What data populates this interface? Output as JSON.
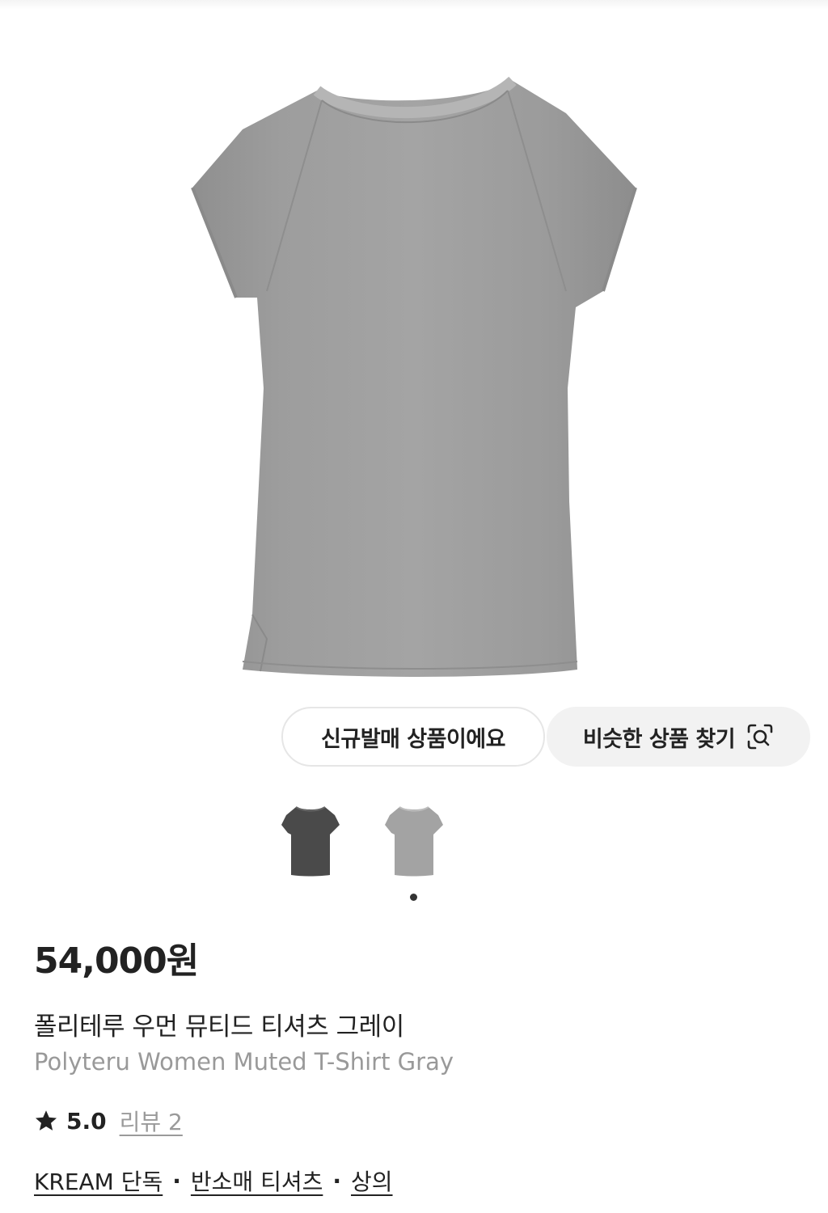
{
  "badges": {
    "new_release": "신규발매 상품이에요",
    "find_similar": "비슷한 상품 찾기"
  },
  "icons": {
    "find_similar": "image-search-lens-icon",
    "rating": "star-icon"
  },
  "colors": {
    "shirt_gray": "#9a9a9a",
    "shirt_charcoal": "#4a4a4a",
    "text_primary": "#222222",
    "text_secondary": "#999999"
  },
  "gallery": {
    "thumbnails": [
      {
        "name": "charcoal-variant",
        "color": "#4a4a4a"
      },
      {
        "name": "gray-variant",
        "color": "#a0a0a0"
      }
    ],
    "active_index": 1
  },
  "product": {
    "price": "54,000원",
    "name_ko": "폴리테루 우먼 뮤티드 티셔츠 그레이",
    "name_en": "Polyteru Women Muted T-Shirt Gray",
    "rating": "5.0",
    "review_label": "리뷰 2",
    "tags": [
      {
        "label": "KREAM 단독"
      },
      {
        "label": "반소매 티셔츠"
      },
      {
        "label": "상의"
      }
    ],
    "tag_separator": "·"
  }
}
